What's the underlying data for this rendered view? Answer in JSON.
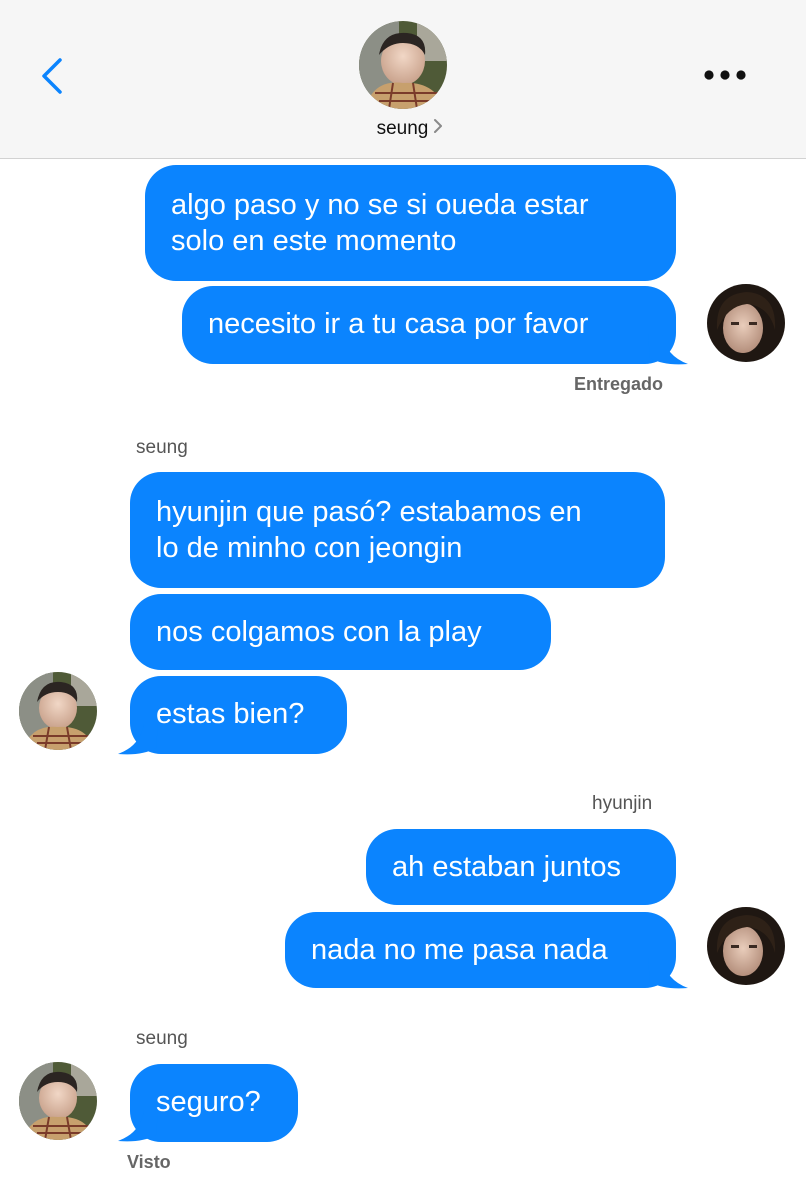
{
  "header": {
    "contact_name": "seung",
    "back_icon": "chevron-left-icon",
    "more_icon": "more-horizontal-icon",
    "accent_color": "#0b84fe"
  },
  "thread": {
    "bubble_color": "#0b84fe",
    "messages": [
      {
        "from": "me",
        "text": [
          "algo paso y no se si oueda estar",
          "solo en este momento"
        ]
      },
      {
        "from": "me",
        "text": [
          "necesito ir a tu casa por favor"
        ]
      },
      {
        "from": "them",
        "text": [
          "hyunjin que pasó? estabamos en",
          "lo de minho con jeongin"
        ]
      },
      {
        "from": "them",
        "text": [
          "nos colgamos con la play"
        ]
      },
      {
        "from": "them",
        "text": [
          "estas bien?"
        ]
      },
      {
        "from": "me",
        "text": [
          "ah estaban juntos"
        ]
      },
      {
        "from": "me",
        "text": [
          "nada no me pasa nada"
        ]
      },
      {
        "from": "them",
        "text": [
          "seguro?"
        ]
      }
    ],
    "senders": [
      "seung",
      "seung",
      "hyunjin",
      "seung"
    ],
    "statuses": [
      "Entregado",
      "Visto"
    ]
  }
}
